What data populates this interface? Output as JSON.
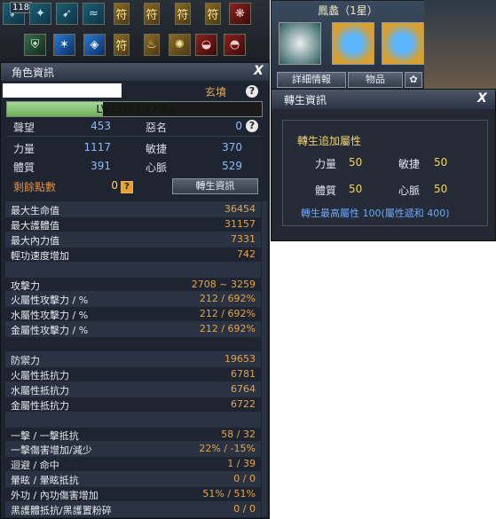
{
  "skillbar": {
    "slot_count_label": "118",
    "row1_icons": [
      "arrow-shield-icon",
      "crane-stance-icon",
      "flying-kick-icon",
      "wave-slash-icon",
      "talisman-icon",
      "talisman-icon",
      "talisman-icon",
      "talisman-icon",
      "fan-icon"
    ],
    "row2_icons": [
      "jade-shield-icon",
      "crystal-burst-icon",
      "blue-rune-icon",
      "talisman-icon",
      "candle-icon",
      "golden-talisman-icon",
      "watermelon-icon",
      "cake-icon"
    ]
  },
  "pet": {
    "title": "鳳蠡（1星）",
    "detail_button": "詳細情報",
    "items_button": "物品"
  },
  "character": {
    "title": "角色資訊",
    "name_box": "",
    "realm": "玄墳",
    "level_text": "LV.53(37.77%)",
    "level_progress": 0.3777,
    "reputation_label": "聲望",
    "reputation_value": "453",
    "infamy_label": "惡名",
    "infamy_value": "0",
    "strength_label": "力量",
    "strength_value": "1117",
    "agility_label": "敏捷",
    "agility_value": "370",
    "constitution_label": "體質",
    "constitution_value": "391",
    "pulse_label": "心脈",
    "pulse_value": "529",
    "remaining_label": "剩餘點數",
    "remaining_value": "0",
    "reincarnation_button": "轉生資訊"
  },
  "stats": [
    {
      "label": "最大生命值",
      "value": "36454"
    },
    {
      "label": "最大護體值",
      "value": "31157"
    },
    {
      "label": "最大內力值",
      "value": "7331"
    },
    {
      "label": "輕功速度增加",
      "value": "742"
    },
    {
      "label": "",
      "value": ""
    },
    {
      "label": "攻擊力",
      "value": "2708 ~ 3259"
    },
    {
      "label": "火屬性攻擊力 / %",
      "value": "212 / 692%"
    },
    {
      "label": "水屬性攻擊力 / %",
      "value": "212 / 692%"
    },
    {
      "label": "金屬性攻擊力 / %",
      "value": "212 / 692%"
    },
    {
      "label": "",
      "value": ""
    },
    {
      "label": "防禦力",
      "value": "19653"
    },
    {
      "label": "火屬性抵抗力",
      "value": "6781"
    },
    {
      "label": "水屬性抵抗力",
      "value": "6764"
    },
    {
      "label": "金屬性抵抗力",
      "value": "6722"
    },
    {
      "label": "",
      "value": ""
    },
    {
      "label": "一擊 / 一擊抵抗",
      "value": "58 / 32"
    },
    {
      "label": "一擊傷害增加/減少",
      "value": "22% / -15%"
    },
    {
      "label": "迴避 / 命中",
      "value": "1 / 39"
    },
    {
      "label": "暈眩 / 暈眩抵抗",
      "value": "0 / 0"
    },
    {
      "label": "外功 / 內功傷害增加",
      "value": "51% / 51%"
    },
    {
      "label": "黑護體抵抗/黑護置粉碎",
      "value": "0 / 0"
    }
  ],
  "reincarnation": {
    "title": "轉生資訊",
    "heading": "轉生追加屬性",
    "strength_label": "力量",
    "strength_value": "50",
    "agility_label": "敏捷",
    "agility_value": "50",
    "constitution_label": "體質",
    "constitution_value": "50",
    "pulse_label": "心脈",
    "pulse_value": "50",
    "note": "轉生最高屬性 100(屬性遞和 400)"
  },
  "close_symbol": "X",
  "help_symbol": "?"
}
